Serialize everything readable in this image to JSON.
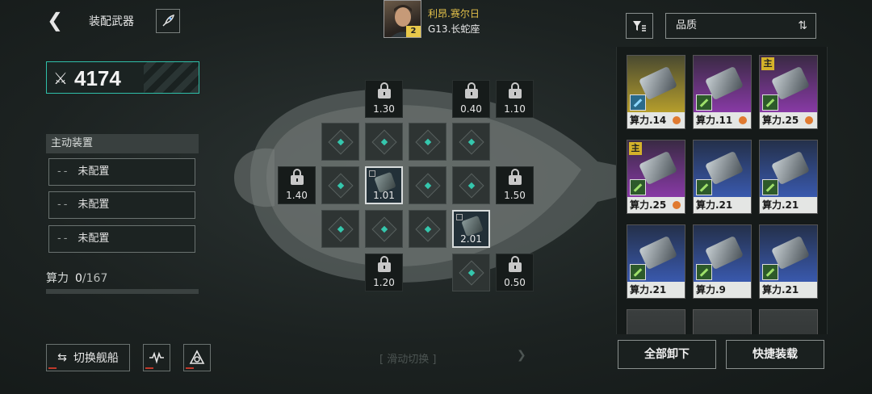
{
  "header": {
    "back_icon": "chevron-left-icon",
    "title": "装配武器",
    "rocket_icon": "rocket-icon"
  },
  "pilot": {
    "name": "利昂.赛尔日",
    "ship": "G13.长蛇座",
    "level": "2"
  },
  "power": {
    "value": "4174",
    "icon": "crossed-swords-icon"
  },
  "active_devices": {
    "heading": "主动装置",
    "slots": [
      {
        "dash": "--",
        "label": "未配置"
      },
      {
        "dash": "--",
        "label": "未配置"
      },
      {
        "dash": "--",
        "label": "未配置"
      }
    ],
    "calc_label": "算力",
    "calc_value": "0",
    "calc_max": "/167"
  },
  "bottom": {
    "switch_label": "切换舰船",
    "swipe_label": "[ 滑动切换 ]"
  },
  "grid": {
    "locked": [
      {
        "value": "1.30"
      },
      {
        "value": "0.40"
      },
      {
        "value": "1.10"
      },
      {
        "value": "1.40"
      },
      {
        "value": "1.50"
      },
      {
        "value": "1.20"
      },
      {
        "value": "0.50"
      }
    ],
    "equipped": [
      {
        "value": "1.01"
      },
      {
        "value": "2.01"
      }
    ]
  },
  "sort": {
    "label": "品质"
  },
  "cards": [
    {
      "power": "算力.14",
      "quality": "yellow",
      "main": false,
      "gear": true
    },
    {
      "power": "算力.11",
      "quality": "purple",
      "main": false,
      "gear": true
    },
    {
      "power": "算力.25",
      "quality": "purple",
      "main": true,
      "gear": true
    },
    {
      "power": "算力.25",
      "quality": "purple",
      "main": true,
      "gear": true
    },
    {
      "power": "算力.21",
      "quality": "blue",
      "main": false,
      "gear": false
    },
    {
      "power": "算力.21",
      "quality": "blue",
      "main": false,
      "gear": false
    },
    {
      "power": "算力.21",
      "quality": "blue",
      "main": false,
      "gear": false
    },
    {
      "power": "算力.9",
      "quality": "blue",
      "main": false,
      "gear": false
    },
    {
      "power": "算力.21",
      "quality": "blue",
      "main": false,
      "gear": false
    }
  ],
  "main_tag": "主",
  "actions": {
    "unload_all": "全部卸下",
    "quick_load": "快捷装载"
  },
  "colors": {
    "accent": "#35c7ad",
    "gold": "#e2c04a"
  }
}
